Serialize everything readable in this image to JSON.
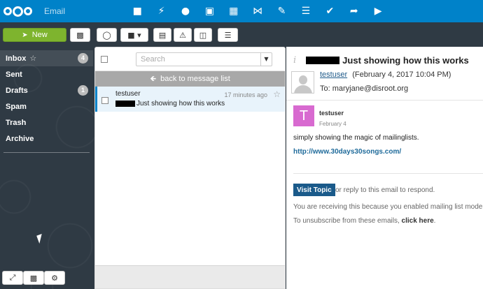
{
  "app": {
    "title": "Email",
    "nav_icons": [
      "files-icon",
      "activity-icon",
      "contacts-icon",
      "gallery-icon",
      "calendar-icon",
      "circles-icon",
      "notes-icon",
      "news-icon",
      "tasks-icon",
      "deck-icon",
      "talk-icon"
    ]
  },
  "toolbar": {
    "new_label": "New",
    "icons": [
      "contact-card-icon",
      "refresh-icon",
      "move-folder-icon",
      "archive-icon",
      "spam-warning-icon",
      "trash-icon",
      "menu-icon"
    ]
  },
  "sidebar": {
    "folders": [
      {
        "label": "Inbox",
        "count": "4",
        "starred": true
      },
      {
        "label": "Sent",
        "count": ""
      },
      {
        "label": "Drafts",
        "count": "1"
      },
      {
        "label": "Spam",
        "count": ""
      },
      {
        "label": "Trash",
        "count": ""
      },
      {
        "label": "Archive",
        "count": ""
      }
    ],
    "bottom_icons": [
      "collapse-icon",
      "add-folder-icon",
      "settings-icon"
    ]
  },
  "message_list": {
    "search_placeholder": "Search",
    "back_label": "back to message list",
    "messages": [
      {
        "from": "testuser",
        "subject": "Just showing how this works",
        "time": "17 minutes ago"
      }
    ]
  },
  "message_view": {
    "subject": "Just showing how this works",
    "from_name": "testuser",
    "date": "(February 4, 2017 10:04 PM)",
    "to": "To: maryjane@disroot.org",
    "topic_author_initial": "T",
    "topic_author": "testuser",
    "topic_date": "February 4",
    "body_text": "simply showing the magic of mailinglists.",
    "link": "http://www.30days30songs.com/",
    "visit_label": "Visit Topic",
    "reply_text": "or reply to this email to respond.",
    "received_text": "You are receiving this because you enabled mailing list mode.",
    "unsubscribe_prefix": "To unsubscribe from these emails,",
    "unsubscribe_link": "click here",
    "unsubscribe_suffix": "."
  },
  "colors": {
    "header": "#0082c9",
    "new_button": "#7eb42e",
    "avatar": "#d86ad0",
    "visit_button": "#1a5a8a"
  }
}
